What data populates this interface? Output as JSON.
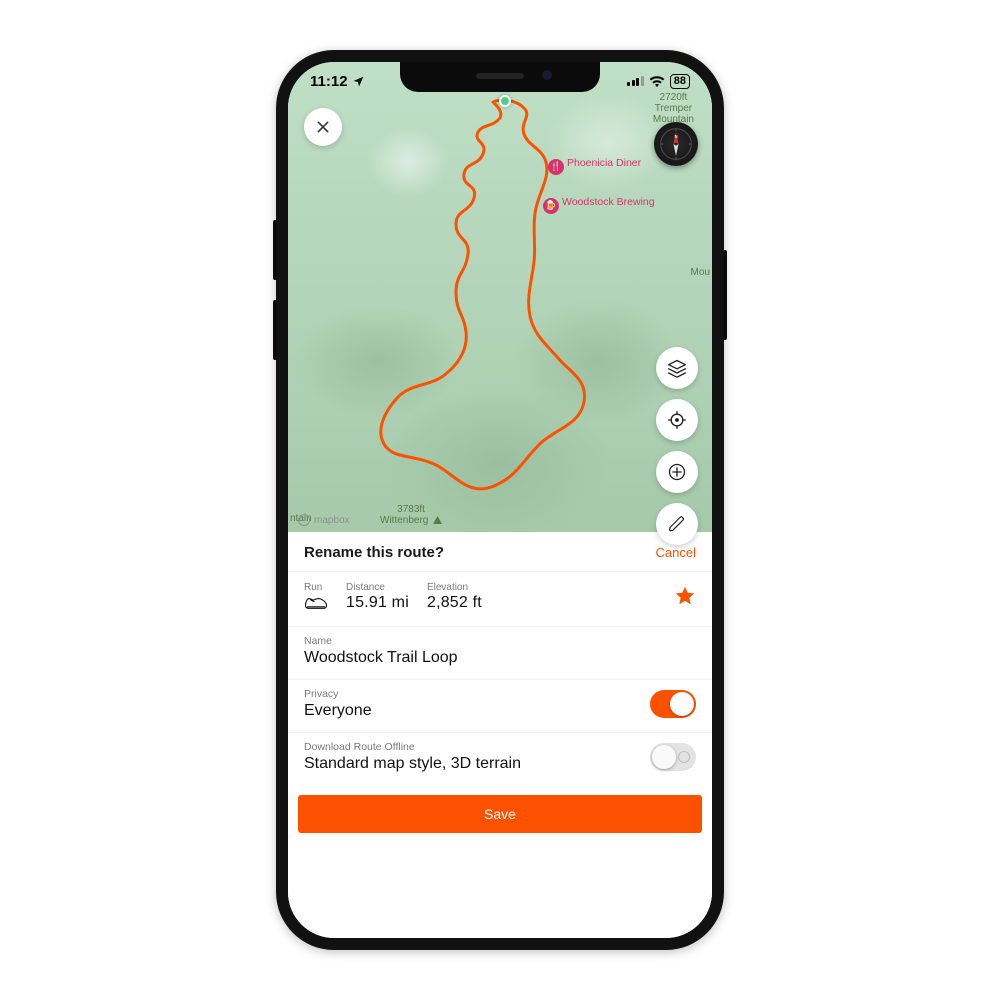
{
  "statusbar": {
    "time": "11:12",
    "battery": "88"
  },
  "map": {
    "poi": {
      "diner": "Phoenicia Diner",
      "brewing": "Woodstock Brewing",
      "tremper_elev": "2720ft",
      "tremper_name": "Tremper",
      "tremper_sub": "Mountain",
      "mou_cut": "Mou",
      "wittenberg_elev": "3783ft",
      "wittenberg": "Wittenberg",
      "ntain_cut": "ntain"
    },
    "attribution": "mapbox"
  },
  "sheet": {
    "title": "Rename this route?",
    "cancel": "Cancel",
    "stats": {
      "run_label": "Run",
      "distance_label": "Distance",
      "distance_value": "15.91 mi",
      "elevation_label": "Elevation",
      "elevation_value": "2,852 ft"
    },
    "name_label": "Name",
    "name_value": "Woodstock Trail Loop",
    "privacy_label": "Privacy",
    "privacy_value": "Everyone",
    "offline_label": "Download Route Offline",
    "offline_value": "Standard map style, 3D terrain",
    "save": "Save"
  },
  "colors": {
    "accent": "#fc5200"
  }
}
